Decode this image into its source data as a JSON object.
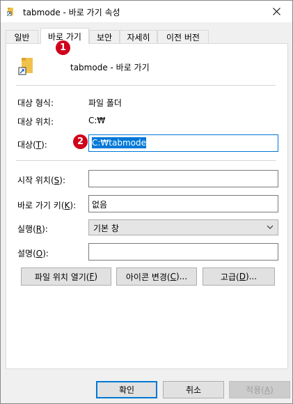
{
  "window": {
    "title": "tabmode - 바로 가기 속성",
    "close_glyph": "✕"
  },
  "tabs": [
    {
      "label": "일반"
    },
    {
      "label": "바로 가기"
    },
    {
      "label": "보안"
    },
    {
      "label": "자세히"
    },
    {
      "label": "이전 버전"
    }
  ],
  "header": {
    "name": "tabmode - 바로 가기"
  },
  "info": {
    "type_label": "대상 형식:",
    "type_value": "파일 폴더",
    "location_label": "대상 위치:",
    "location_value": "C:₩"
  },
  "target": {
    "label_prefix": "대상(",
    "label_key": "T",
    "label_suffix": "):",
    "value_prefix": "C:₩tabmode",
    "value_selected": "C:₩tabmode"
  },
  "start_in": {
    "label_prefix": "시작 위치(",
    "label_key": "S",
    "label_suffix": "):",
    "value": ""
  },
  "shortcut_key": {
    "label_prefix": "바로 가기 키(",
    "label_key": "K",
    "label_suffix": "):",
    "value": "없음"
  },
  "run": {
    "label_prefix": "실행(",
    "label_key": "R",
    "label_suffix": "):",
    "value": "기본 창"
  },
  "comment": {
    "label_prefix": "설명(",
    "label_key": "O",
    "label_suffix": "):",
    "value": ""
  },
  "action_buttons": {
    "open_location_prefix": "파일 위치 열기(",
    "open_location_key": "F",
    "open_location_suffix": ")",
    "change_icon_prefix": "아이콘 변경(",
    "change_icon_key": "C",
    "change_icon_suffix": ")...",
    "advanced_prefix": "고급(",
    "advanced_key": "D",
    "advanced_suffix": ")..."
  },
  "dialog_buttons": {
    "ok": "확인",
    "cancel": "취소",
    "apply_prefix": "적용(",
    "apply_key": "A",
    "apply_suffix": ")"
  },
  "badges": {
    "one": "1",
    "two": "2"
  },
  "colors": {
    "accent": "#0078d7",
    "badge": "#d0021b",
    "folder": "#f0c24b"
  }
}
